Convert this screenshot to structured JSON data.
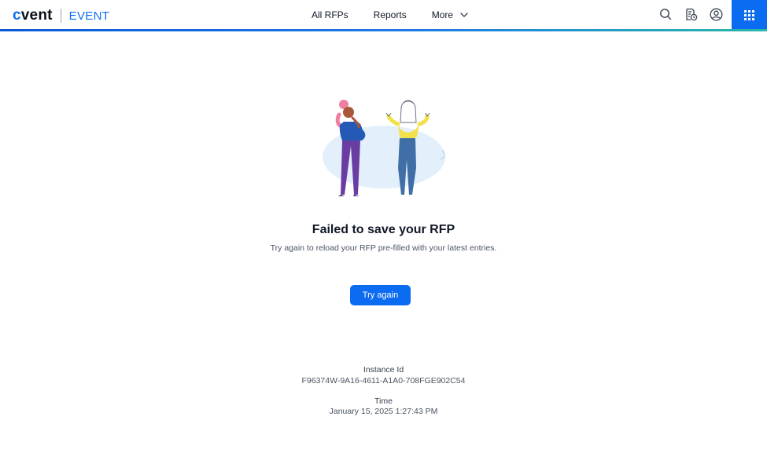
{
  "header": {
    "brand_logo_prefix": "c",
    "brand_logo_rest": "vent",
    "product": "EVENT",
    "nav": [
      {
        "label": "All RFPs"
      },
      {
        "label": "Reports"
      },
      {
        "label": "More"
      }
    ],
    "icons": [
      "search-icon",
      "task-list-icon",
      "user-account-icon",
      "app-grid-icon"
    ],
    "accent_color": "#0b6cf2"
  },
  "error": {
    "title": "Failed to save your RFP",
    "message": "Try again to reload your RFP pre-filled with your latest entries.",
    "button_label": "Try again"
  },
  "details": {
    "instance_label": "Instance Id",
    "instance_value": "F96374W-9A16-4611-A1A0-708FGE902C54",
    "time_label": "Time",
    "time_value": "January 15, 2025 1:27:43 PM"
  }
}
